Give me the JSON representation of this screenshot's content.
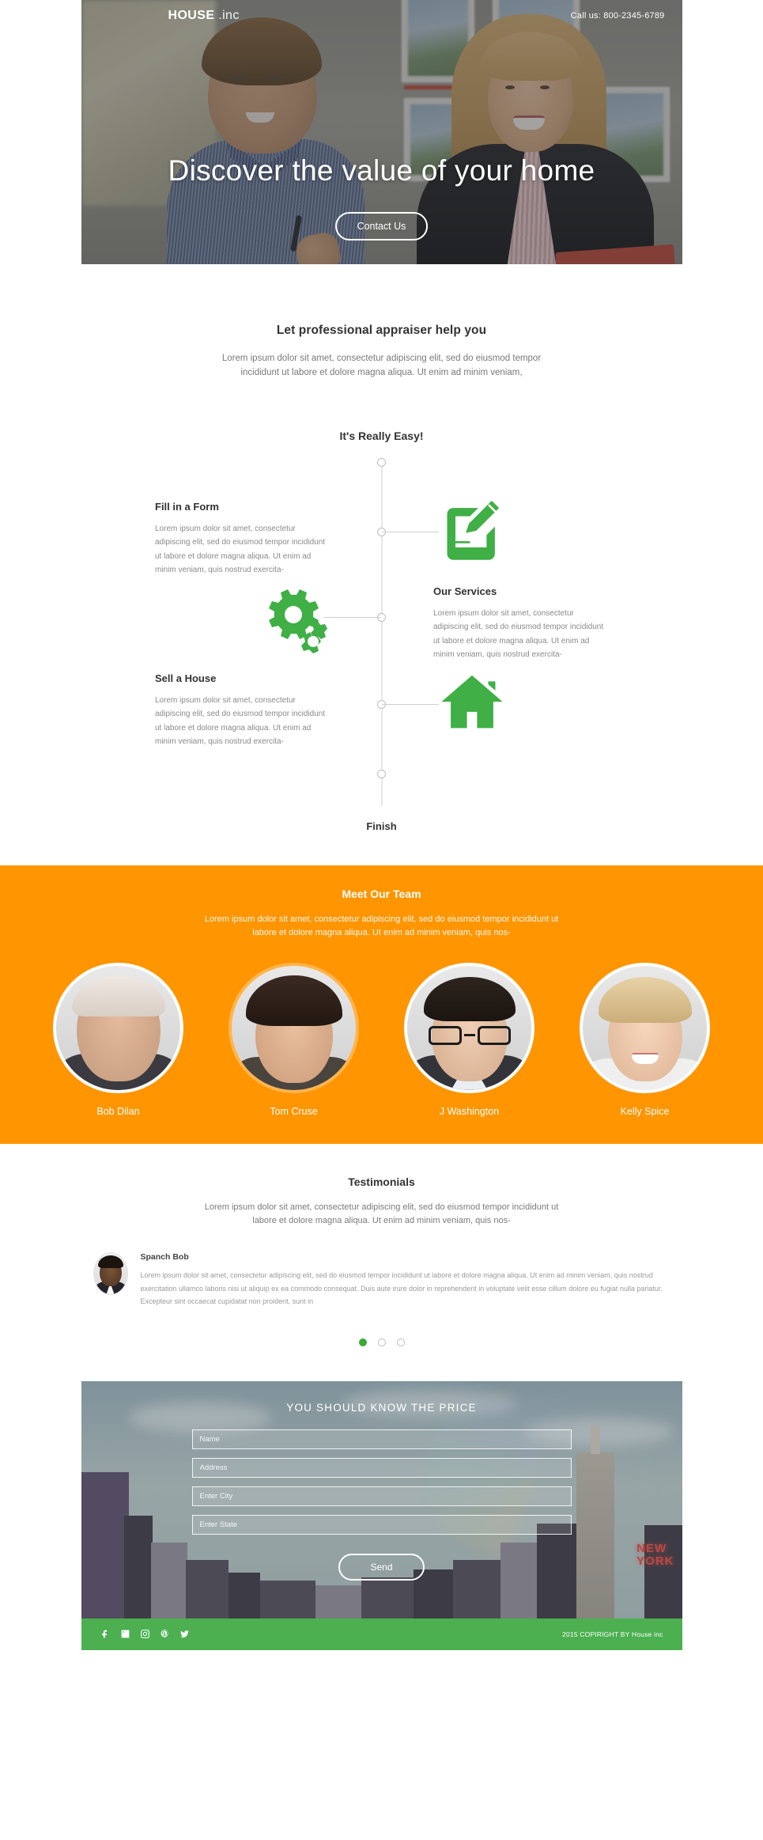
{
  "hero": {
    "logo_bold": "HOUSE",
    "logo_light": " .inc",
    "phone": "Call us: 800-2345-6789",
    "title": "Discover the value of your home",
    "cta_label": "Contact Us"
  },
  "intro": {
    "heading": "Let professional appraiser help you",
    "paragraph": "Lorem ipsum dolor sit amet, consectetur adipiscing elit, sed do eiusmod tempor incididunt ut labore et dolore magna aliqua. Ut enim ad minim veniam,"
  },
  "timeline": {
    "heading": "It's Really Easy!",
    "finish": "Finish",
    "steps": [
      {
        "title": "Fill in a Form",
        "text": "Lorem ipsum dolor sit amet, consectetur adipiscing elit, sed do eiusmod tempor incididunt ut labore et dolore magna aliqua. Ut enim ad minim veniam, quis nostrud exercita-",
        "icon": "pencil-edit-icon"
      },
      {
        "title": "Our Services",
        "text": "Lorem ipsum dolor sit amet, consectetur adipiscing elit, sed do eiusmod tempor incididunt ut labore et dolore magna aliqua. Ut enim ad minim veniam, quis nostrud exercita-",
        "icon": "gears-icon"
      },
      {
        "title": "Sell a House",
        "text": "Lorem ipsum dolor sit amet, consectetur adipiscing elit, sed do eiusmod tempor incididunt ut labore et dolore magna aliqua. Ut enim ad minim veniam, quis nostrud exercita-",
        "icon": "house-icon"
      }
    ]
  },
  "team": {
    "heading": "Meet Our Team",
    "paragraph": "Lorem ipsum dolor sit amet, consectetur adipiscing elit, sed do eiusmod tempor incididunt ut labore et dolore magna aliqua. Ut enim ad minim veniam, quis nos-",
    "members": [
      {
        "name": "Bob Dilan"
      },
      {
        "name": "Tom Cruse"
      },
      {
        "name": "J Washington"
      },
      {
        "name": "Kelly Spice"
      }
    ]
  },
  "testimonials": {
    "heading": "Testimonials",
    "paragraph": "Lorem ipsum dolor sit amet, consectetur adipiscing elit, sed do eiusmod tempor incididunt ut labore et dolore magna aliqua. Ut enim ad minim veniam, quis nos-",
    "quote": {
      "name": "Spanch Bob",
      "text": "Lorem ipsum dolor sit amet, consectetur adipiscing elit, sed do eiusmod tempor incididunt ut labore et dolore magna aliqua. Ut enim ad minim veniam, quis nostrud exercitation ullamco laboris nisi ut aliquip ex ea commodo consequat. Duis aute irure dolor in reprehenderit in voluptate velit esse cillum dolore eu fugiat nulla pariatur. Excepteur sint occaecat cupidatat non proident, sunt in"
    },
    "pager": {
      "count": 3,
      "active": 0
    }
  },
  "cta": {
    "heading": "YOU SHOULD KNOW THE PRICE",
    "fields": [
      {
        "name": "name",
        "placeholder": "Name",
        "value": ""
      },
      {
        "name": "address",
        "placeholder": "Address",
        "value": ""
      },
      {
        "name": "city",
        "placeholder": "Enter City",
        "value": ""
      },
      {
        "name": "state",
        "placeholder": "Enter State",
        "value": ""
      }
    ],
    "send_label": "Send",
    "neon": "NEW\nYORK"
  },
  "footer": {
    "copyright": "2015 COPIRIGHT BY House inc",
    "socials": [
      "facebook-icon",
      "linkedin-icon",
      "instagram-icon",
      "pinterest-icon",
      "twitter-icon"
    ]
  },
  "colors": {
    "orange": "#ff9500",
    "green": "#4caf50",
    "icon_green": "#3faf46",
    "dot_active": "#3aaa35"
  }
}
